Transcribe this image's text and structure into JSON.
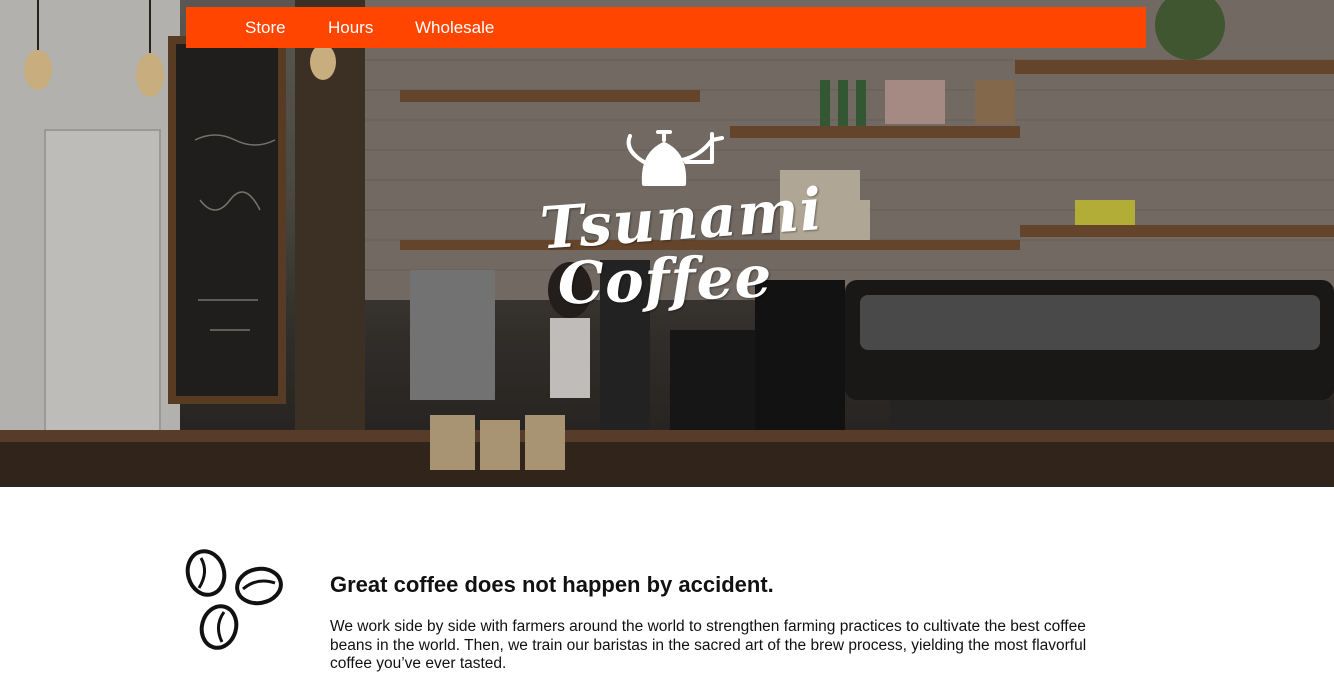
{
  "nav": {
    "items": [
      {
        "label": "Store"
      },
      {
        "label": "Hours"
      },
      {
        "label": "Wholesale"
      }
    ],
    "background": "#ff4500"
  },
  "hero": {
    "logo_line1": "Tsunami",
    "logo_line2": "Coffee",
    "logo_icon": "kettle-icon"
  },
  "intro": {
    "icon": "coffee-beans-icon",
    "heading": "Great coffee does not happen by accident.",
    "body": "We work side by side with farmers around the world to strengthen farming practices to cultivate the best coffee beans in the world. Then, we train our baristas in the sacred art of the brew process, yielding the most flavorful coffee you’ve ever tasted."
  }
}
